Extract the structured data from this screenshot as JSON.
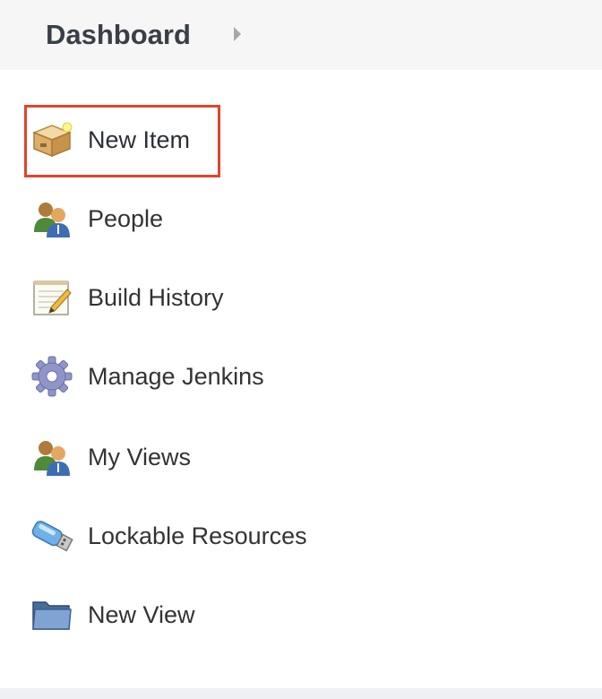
{
  "breadcrumb": {
    "dashboard_label": "Dashboard",
    "arrow_icon": "breadcrumb-arrow-icon"
  },
  "tasks": [
    {
      "label": "New Item",
      "icon": "new-item-box-icon",
      "highlighted": true
    },
    {
      "label": "People",
      "icon": "people-icon"
    },
    {
      "label": "Build History",
      "icon": "notepad-icon"
    },
    {
      "label": "Manage Jenkins",
      "icon": "gear-icon"
    },
    {
      "label": "My Views",
      "icon": "people-icon"
    },
    {
      "label": "Lockable Resources",
      "icon": "usb-drive-icon"
    },
    {
      "label": "New View",
      "icon": "folder-icon"
    }
  ],
  "colors": {
    "highlight_border": "#e0452a",
    "breadcrumb_bg": "#f6f6f7",
    "text": "#333333"
  }
}
